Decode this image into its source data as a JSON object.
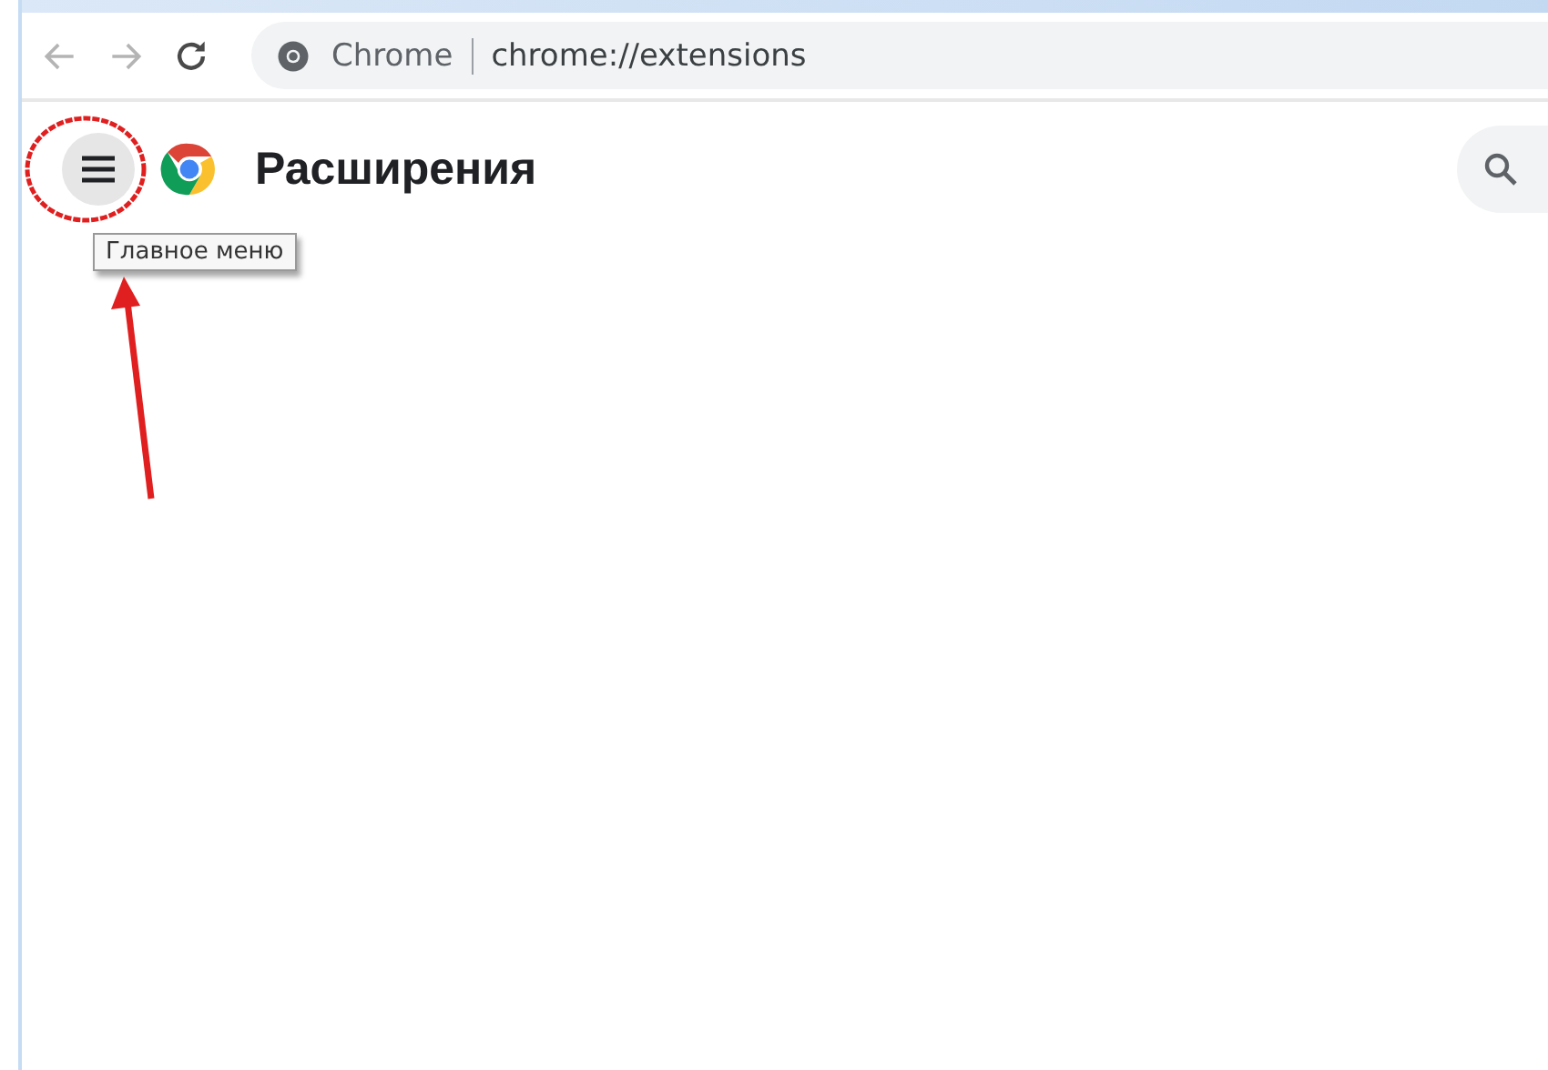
{
  "toolbar": {
    "site_label": "Chrome",
    "url": "chrome://extensions"
  },
  "header": {
    "title": "Расширения",
    "menu_tooltip": "Главное меню"
  }
}
